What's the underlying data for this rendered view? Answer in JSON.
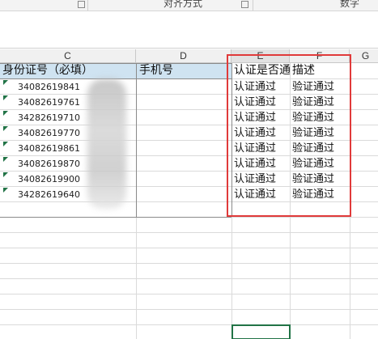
{
  "ribbon": {
    "alignment_group": "对齐方式",
    "number_group": "数字"
  },
  "columns": [
    "C",
    "D",
    "E",
    "F",
    "G"
  ],
  "header_row": {
    "c": "身份证号（必填）",
    "d": "手机号",
    "e": "认证是否通过",
    "f": "描述"
  },
  "rows": [
    {
      "id": "34082619841",
      "e": "认证通过",
      "f": "验证通过"
    },
    {
      "id": "34082619761",
      "e": "认证通过",
      "f": "验证通过"
    },
    {
      "id": "34282619710",
      "e": "认证通过",
      "f": "验证通过"
    },
    {
      "id": "34082619770",
      "e": "认证通过",
      "f": "验证通过"
    },
    {
      "id": "34082619861",
      "e": "认证通过",
      "f": "验证通过"
    },
    {
      "id": "34082619870",
      "e": "认证通过",
      "f": "验证通过"
    },
    {
      "id": "34082619900",
      "e": "认证通过",
      "f": "验证通过"
    },
    {
      "id": "34282619640",
      "e": "认证通过",
      "f": "验证通过"
    }
  ],
  "colors": {
    "header_fill": "#cfe3f1",
    "highlight_box": "#e03a3a",
    "selection": "#217346"
  }
}
